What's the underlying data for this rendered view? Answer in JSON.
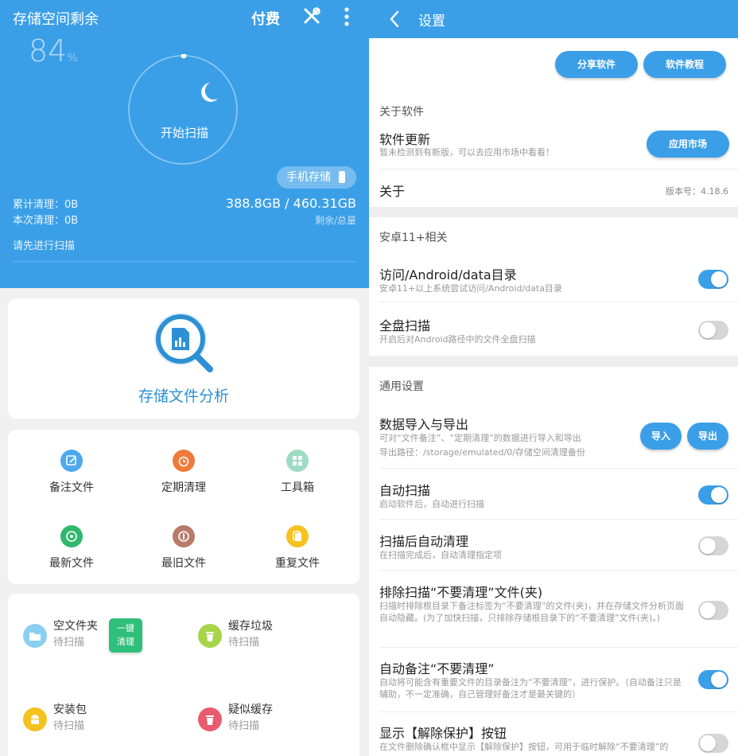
{
  "left": {
    "header": {
      "title": "存储空间剩余",
      "pay_label": "付费",
      "tools_icon": "wrench-screwdriver-icon",
      "more_icon": "more-vert-icon"
    },
    "storage": {
      "percent": "84",
      "percent_unit": "%",
      "scan_button": "开始扫描",
      "phone_storage_label": "手机存储",
      "cumulative_clean": "累计清理：0B",
      "this_clean": "本次清理：0B",
      "capacity": "388.8GB / 460.31GB",
      "capacity_sub": "剩余/总量",
      "prompt": "请先进行扫描"
    },
    "analysis": {
      "label": "存储文件分析"
    },
    "grid": [
      {
        "label": "备注文件",
        "color": "#4ea8ee"
      },
      {
        "label": "定期清理",
        "color": "#f07a3a"
      },
      {
        "label": "工具箱",
        "color": "#9cdcc2"
      },
      {
        "label": "最新文件",
        "color": "#2fb86e"
      },
      {
        "label": "最旧文件",
        "color": "#b77b6a"
      },
      {
        "label": "重复文件",
        "color": "#f6c21f"
      }
    ],
    "junk": [
      {
        "title": "空文件夹",
        "status": "待扫描",
        "color": "#8bcff0"
      },
      {
        "title": "缓存垃圾",
        "status": "待扫描",
        "color": "#a8d44a"
      },
      {
        "title": "安装包",
        "status": "待扫描",
        "color": "#f4c21e"
      },
      {
        "title": "疑似缓存",
        "status": "待扫描",
        "color": "#ea5a6e"
      }
    ],
    "one_click": [
      "一键",
      "清理"
    ]
  },
  "right": {
    "header": {
      "title": "设置",
      "back_icon": "arrow-back-icon"
    },
    "share_button": "分享软件",
    "tutorial_button": "软件教程",
    "about_section": {
      "head": "关于软件",
      "update_title": "软件更新",
      "update_desc": "暂未检测到有新版，可以去应用市场中看看！",
      "market_button": "应用市场",
      "about_title": "关于",
      "version": "版本号：4.18.6"
    },
    "android_section": {
      "head": "安卓11+相关",
      "items": [
        {
          "title": "访问/Android/data目录",
          "desc": "安卓11+以上系统尝试访问/Android/data目录",
          "on": true
        },
        {
          "title": "全盘扫描",
          "desc": "开启后对Android路径中的文件全盘扫描",
          "on": false
        }
      ]
    },
    "general_section": {
      "head": "通用设置",
      "import_title": "数据导入与导出",
      "import_desc": "可对“文件备注”、“定期清理”的数据进行导入和导出",
      "import_path": "导出路径：/storage/emulated/0/存储空间清理备份",
      "import_button": "导入",
      "export_button": "导出",
      "items": [
        {
          "title": "自动扫描",
          "desc": "启动软件后，自动进行扫描",
          "on": true
        },
        {
          "title": "扫描后自动清理",
          "desc": "在扫描完成后，自动清理指定项",
          "on": false
        },
        {
          "title": "排除扫描“不要清理”文件(夹)",
          "desc": "扫描时排除根目录下备注标签为“不要清理”的文件(夹)，并在存储文件分析页面自动隐藏。(为了加快扫描，只排除存储根目录下的“不要清理”文件(夹)。)",
          "on": false
        },
        {
          "title": "自动备注“不要清理”",
          "desc": "自动将可能含有重要文件的目录备注为“不要清理”，进行保护。（自动备注只是辅助，不一定准确，自己管理好备注才是最关键的）",
          "on": true
        },
        {
          "title": "显示【解除保护】按钮",
          "desc": "在文件删除确认框中显示【解除保护】按钮，可用于临时解除“不要清理”的",
          "on": false
        }
      ]
    }
  }
}
